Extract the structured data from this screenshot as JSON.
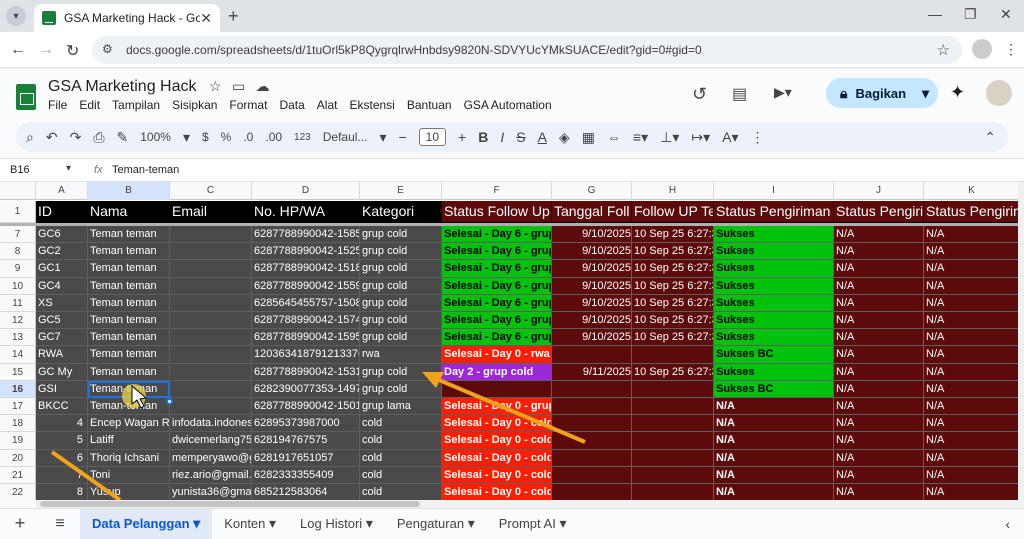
{
  "browser": {
    "tab_title": "GSA Marketing Hack - Google S",
    "url": "docs.google.com/spreadsheets/d/1tuOrl5kP8QygrqlrwHnbdsy9820N-SDVYUcYMkSUACE/edit?gid=0#gid=0"
  },
  "app": {
    "title": "GSA Marketing Hack",
    "menus": [
      "File",
      "Edit",
      "Tampilan",
      "Sisipkan",
      "Format",
      "Data",
      "Alat",
      "Ekstensi",
      "Bantuan",
      "GSA Automation"
    ],
    "share_label": "Bagikan"
  },
  "toolbar": {
    "zoom": "100%",
    "currency": "$",
    "percent": "%",
    "dec": ".0",
    "dec2": ".00",
    "num": "123",
    "font": "Defaul...",
    "size": "10"
  },
  "formula": {
    "cell_ref": "B16",
    "fx": "fx",
    "value": "Teman-teman"
  },
  "columns": [
    "A",
    "B",
    "C",
    "D",
    "E",
    "F",
    "G",
    "H",
    "I",
    "J",
    "K"
  ],
  "header_row": {
    "num": "1",
    "cells": [
      "ID",
      "Nama",
      "Email",
      "No. HP/WA",
      "Kategori",
      "Status Follow Up",
      "Tanggal Foll",
      "Follow UP Te",
      "Status Pengiriman",
      "Status Pengirim",
      "Status Pengirim"
    ]
  },
  "rows": [
    {
      "num": "7",
      "cells": [
        "GC6",
        "Teman teman",
        "",
        "6287788990042-1585:",
        "grup cold",
        "Selesai - Day 6 - grup",
        "9/10/2025",
        "10 Sep 25 6:27:3",
        "Sukses",
        "N/A",
        "N/A"
      ]
    },
    {
      "num": "8",
      "cells": [
        "GC2",
        "Teman teman",
        "",
        "6287788990042-1525(",
        "grup cold",
        "Selesai - Day 6 - grup",
        "9/10/2025",
        "10 Sep 25 6:27:3",
        "Sukses",
        "N/A",
        "N/A"
      ]
    },
    {
      "num": "9",
      "cells": [
        "GC1",
        "Teman teman",
        "",
        "6287788990042-1518(",
        "grup cold",
        "Selesai - Day 6 - grup",
        "9/10/2025",
        "10 Sep 25 6:27:3",
        "Sukses",
        "N/A",
        "N/A"
      ]
    },
    {
      "num": "10",
      "cells": [
        "GC4",
        "Teman teman",
        "",
        "6287788990042-1559(",
        "grup cold",
        "Selesai - Day 6 - grup",
        "9/10/2025",
        "10 Sep 25 6:27:3",
        "Sukses",
        "N/A",
        "N/A"
      ]
    },
    {
      "num": "11",
      "cells": [
        "XS",
        "Teman teman",
        "",
        "6285645455757-1508",
        "grup cold",
        "Selesai - Day 6 - grup",
        "9/10/2025",
        "10 Sep 25 6:27:3",
        "Sukses",
        "N/A",
        "N/A"
      ]
    },
    {
      "num": "12",
      "cells": [
        "GC5",
        "Teman teman",
        "",
        "6287788990042-1574:",
        "grup cold",
        "Selesai - Day 6 - grup",
        "9/10/2025",
        "10 Sep 25 6:27:3",
        "Sukses",
        "N/A",
        "N/A"
      ]
    },
    {
      "num": "13",
      "cells": [
        "GC7",
        "Teman teman",
        "",
        "6287788990042-1595:",
        "grup cold",
        "Selesai - Day 6 - grup",
        "9/10/2025",
        "10 Sep 25 6:27:3",
        "Sukses",
        "N/A",
        "N/A"
      ]
    },
    {
      "num": "14",
      "cells": [
        "RWA",
        "Teman teman",
        "",
        "120363418791213376",
        "rwa",
        "Selesai - Day 0 - rwa",
        "",
        "",
        "Sukses BC",
        "N/A",
        "N/A"
      ]
    },
    {
      "num": "15",
      "cells": [
        "GC My",
        "Teman teman",
        "",
        "6287788990042-1531(",
        "grup cold",
        "Day 2 - grup cold",
        "9/11/2025",
        "10 Sep 25 6:27:3",
        "Sukses",
        "N/A",
        "N/A"
      ]
    },
    {
      "num": "16",
      "cells": [
        "GSI",
        "Teman-teman",
        "",
        "6282390077353-1497(",
        "grup cold",
        "",
        "",
        "",
        "Sukses BC",
        "N/A",
        "N/A"
      ]
    },
    {
      "num": "17",
      "cells": [
        "BKCC",
        "Teman-teman",
        "",
        "6287788990042-1501",
        "grup lama",
        "Selesai - Day 0 - grup lama",
        "",
        "",
        "N/A",
        "N/A",
        "N/A"
      ]
    },
    {
      "num": "18",
      "cells": [
        "4",
        "Encep Wagan R",
        "infodata.indones",
        "62895373987000",
        "cold",
        "Selesai - Day 0 - cold",
        "",
        "",
        "N/A",
        "N/A",
        "N/A"
      ]
    },
    {
      "num": "19",
      "cells": [
        "5",
        "Latiff",
        "dwicemerlang75",
        "628194767575",
        "cold",
        "Selesai - Day 0 - cold",
        "",
        "",
        "N/A",
        "N/A",
        "N/A"
      ]
    },
    {
      "num": "20",
      "cells": [
        "6",
        "Thoriq Ichsani",
        "memperyawo@g",
        "6281917651057",
        "cold",
        "Selesai - Day 0 - cold",
        "",
        "",
        "N/A",
        "N/A",
        "N/A"
      ]
    },
    {
      "num": "21",
      "cells": [
        "7",
        "Toni",
        "riez.ario@gmail.",
        "6282333355409",
        "cold",
        "Selesai - Day 0 - cold",
        "",
        "",
        "N/A",
        "N/A",
        "N/A"
      ]
    },
    {
      "num": "22",
      "cells": [
        "8",
        "Yusup",
        "yunista36@gma",
        "685212583064",
        "cold",
        "Selesai - Day 0 - cold",
        "",
        "",
        "N/A",
        "N/A",
        "N/A"
      ]
    }
  ],
  "sheet_tabs": [
    "Data Pelanggan",
    "Konten",
    "Log Histori",
    "Pengaturan",
    "Prompt AI"
  ],
  "colors": {
    "green": "#00c20a",
    "red": "#ff1e00",
    "purple": "#9c27d6",
    "dark": "#4a4a4a",
    "maroon": "#5c0a0a",
    "orange": "#f2a31a"
  }
}
